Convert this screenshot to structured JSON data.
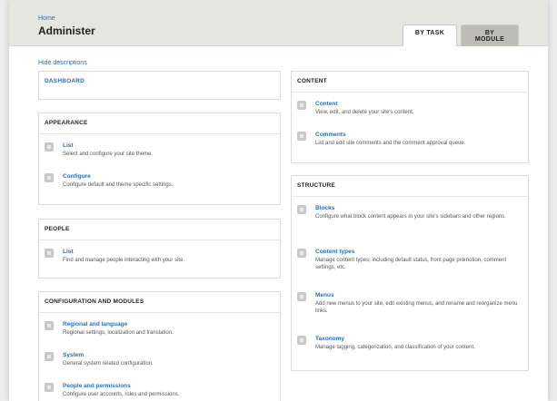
{
  "breadcrumb": {
    "home": "Home"
  },
  "page": {
    "title": "Administer"
  },
  "tabs": {
    "by_task": "BY TASK",
    "by_module": "BY MODULE"
  },
  "hide_descriptions": "Hide descriptions",
  "left": {
    "dashboard": "DASHBOARD",
    "appearance": {
      "title": "APPEARANCE",
      "items": [
        {
          "title": "List",
          "desc": "Select and configure your site theme."
        },
        {
          "title": "Configure",
          "desc": "Configure default and theme specific settings."
        }
      ]
    },
    "people": {
      "title": "PEOPLE",
      "items": [
        {
          "title": "List",
          "desc": "Find and manage people interacting with your site."
        }
      ]
    },
    "config": {
      "title": "CONFIGURATION AND MODULES",
      "items": [
        {
          "title": "Regional and language",
          "desc": "Regional settings, localization and translation."
        },
        {
          "title": "System",
          "desc": "General system related configuration."
        },
        {
          "title": "People and permissions",
          "desc": "Configure user accounts, roles and permissions."
        }
      ]
    }
  },
  "right": {
    "content": {
      "title": "CONTENT",
      "items": [
        {
          "title": "Content",
          "desc": "View, edit, and delete your site's content."
        },
        {
          "title": "Comments",
          "desc": "List and edit site comments and the comment approval queue."
        }
      ]
    },
    "structure": {
      "title": "STRUCTURE",
      "items": [
        {
          "title": "Blocks",
          "desc": "Configure what block content appears in your site's sidebars and other regions."
        },
        {
          "title": "Content types",
          "desc": "Manage content types, including default status, front page promotion, comment settings, etc."
        },
        {
          "title": "Menus",
          "desc": "Add new menus to your site, edit existing menus, and rename and reorganize menu links."
        },
        {
          "title": "Taxonomy",
          "desc": "Manage tagging, categorization, and classification of your content."
        }
      ]
    }
  }
}
